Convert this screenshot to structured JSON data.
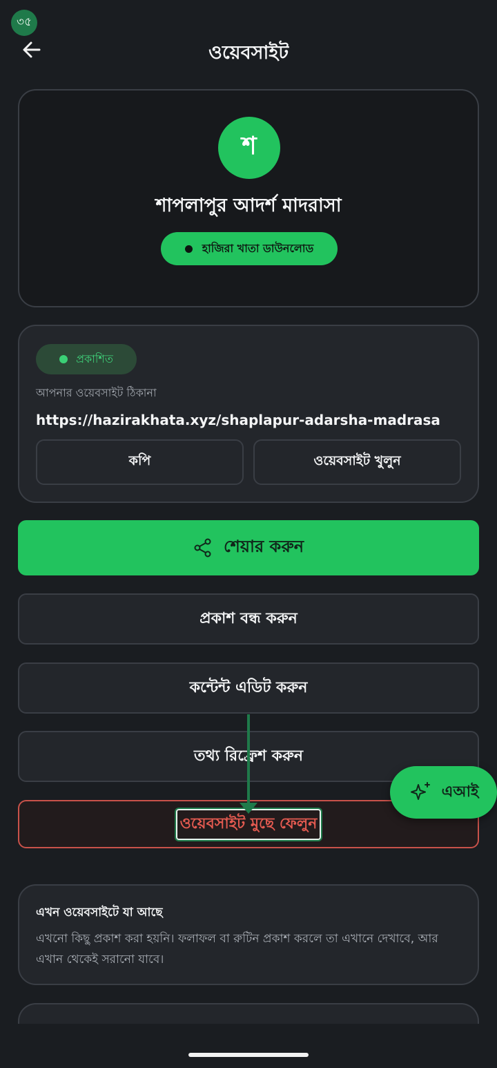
{
  "status": {
    "badge": "৩৫"
  },
  "header": {
    "title": "ওয়েবসাইট"
  },
  "profile": {
    "avatar_letter": "শ",
    "name": "শাপলাপুর আদর্শ মাদরাসা",
    "pill_label": "হাজিরা খাতা ডাউনলোড"
  },
  "website": {
    "status_label": "প্রকাশিত",
    "address_label": "আপনার ওয়েবসাইট ঠিকানা",
    "url": "https://hazirakhata.xyz/shaplapur-adarsha-madrasa",
    "copy_label": "কপি",
    "open_label": "ওয়েবসাইট খুলুন"
  },
  "actions": {
    "share": "শেয়ার করুন",
    "unpublish": "প্রকাশ বন্ধ করুন",
    "edit_content": "কন্টেন্ট এডিট করুন",
    "refresh": "তথ্য রিফ্রেশ করুন",
    "delete": "ওয়েবসাইট মুছে ফেলুন"
  },
  "ai_button": {
    "label": "এআই"
  },
  "info": {
    "title": "এখন ওয়েবসাইটে যা আছে",
    "body": "এখনো কিছু প্রকাশ করা হয়নি। ফলাফল বা রুটিন প্রকাশ করলে তা এখানে দেখাবে, আর এখান থেকেই সরানো যাবে।"
  },
  "colors": {
    "accent": "#22c35e",
    "background": "#1a1d21",
    "danger": "#e35a50"
  }
}
